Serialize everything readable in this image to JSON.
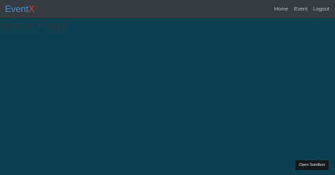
{
  "navbar": {
    "brand_part1": "Event",
    "brand_part2": "X",
    "links": [
      {
        "label": "Home"
      },
      {
        "label": "Event"
      },
      {
        "label": "Logout"
      }
    ]
  },
  "main": {
    "title": "Home Page"
  },
  "sandbox": {
    "button_label": "Open Sandbox"
  },
  "colors": {
    "navbar_bg": "#353b40",
    "page_bg": "#0b4050",
    "brand_blue": "#4f8fd8",
    "brand_red": "#e2403a"
  }
}
